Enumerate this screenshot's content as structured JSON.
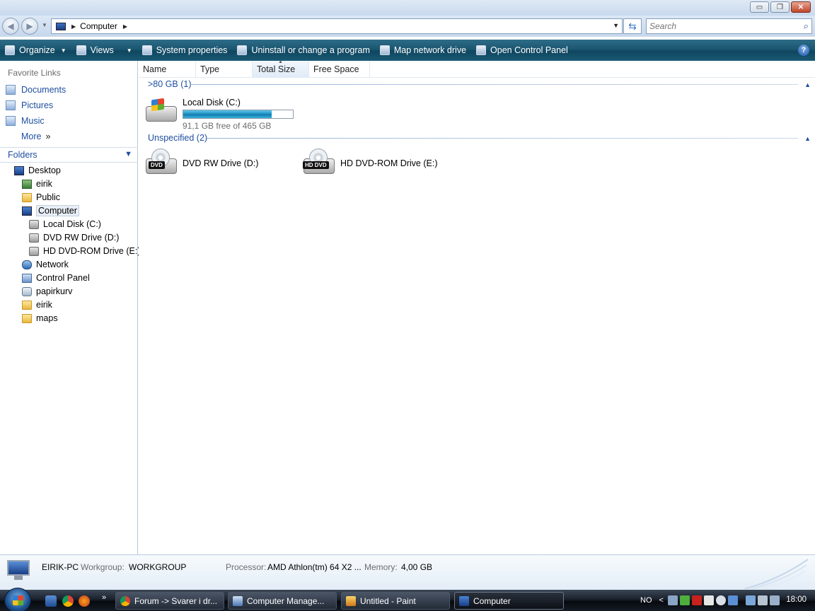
{
  "window": {
    "controls": {
      "minimize": "▭",
      "maximize": "❐",
      "close": "✕"
    }
  },
  "address": {
    "path": "Computer",
    "search_placeholder": "Search"
  },
  "commands": [
    {
      "label": "Organize",
      "has_menu": true
    },
    {
      "label": "Views",
      "has_menu": true
    },
    {
      "label": "System properties"
    },
    {
      "label": "Uninstall or change a program"
    },
    {
      "label": "Map network drive"
    },
    {
      "label": "Open Control Panel"
    }
  ],
  "help_label": "?",
  "sidebar": {
    "favorites_heading": "Favorite Links",
    "favorites": [
      "Documents",
      "Pictures",
      "Music"
    ],
    "more_label": "More",
    "folders_heading": "Folders",
    "tree": [
      {
        "label": "Desktop",
        "icon": "computer-icon"
      },
      {
        "label": "eirik",
        "icon": "user-folder-icon"
      },
      {
        "label": "Public",
        "icon": "folder-icon"
      },
      {
        "label": "Computer",
        "icon": "computer-icon",
        "selected": true
      },
      {
        "label": "Local Disk (C:)",
        "icon": "hard-disk-icon"
      },
      {
        "label": "DVD RW Drive (D:)",
        "icon": "dvd-drive-icon"
      },
      {
        "label": "HD DVD-ROM Drive (E:)",
        "icon": "dvd-drive-icon"
      },
      {
        "label": "Network",
        "icon": "network-icon"
      },
      {
        "label": "Control Panel",
        "icon": "control-panel-icon"
      },
      {
        "label": "papirkurv",
        "icon": "recycle-bin-icon"
      },
      {
        "label": "eirik",
        "icon": "folder-icon"
      },
      {
        "label": "maps",
        "icon": "folder-icon"
      }
    ]
  },
  "columns": [
    "Name",
    "Type",
    "Total Size",
    "Free Space"
  ],
  "groups": [
    {
      "label": ">80 GB (1)",
      "drives": [
        {
          "name": "Local Disk (C:)",
          "free_text": "91,1 GB free of 465 GB",
          "used_fraction": 0.804
        }
      ]
    },
    {
      "label": "Unspecified (2)",
      "drives": [
        {
          "name": "DVD RW Drive (D:)",
          "badge": "DVD"
        },
        {
          "name": "HD DVD-ROM Drive (E:)",
          "badge": "HD DVD"
        }
      ]
    }
  ],
  "details": {
    "computer_name": "EIRIK-PC",
    "workgroup_label": "Workgroup:",
    "workgroup_value": "WORKGROUP",
    "processor_label": "Processor:",
    "processor_value": "AMD Athlon(tm) 64 X2 ...",
    "memory_label": "Memory:",
    "memory_value": "4,00 GB"
  },
  "taskbar": {
    "quicklaunch_more": "»",
    "tasks": [
      {
        "label": "Forum -> Svarer i dr...",
        "active": false
      },
      {
        "label": "Computer Manage...",
        "active": false
      },
      {
        "label": "Untitled - Paint",
        "active": false
      },
      {
        "label": "Computer",
        "active": true
      }
    ],
    "language": "NO",
    "tray_expand": "<",
    "clock": "18:00"
  }
}
